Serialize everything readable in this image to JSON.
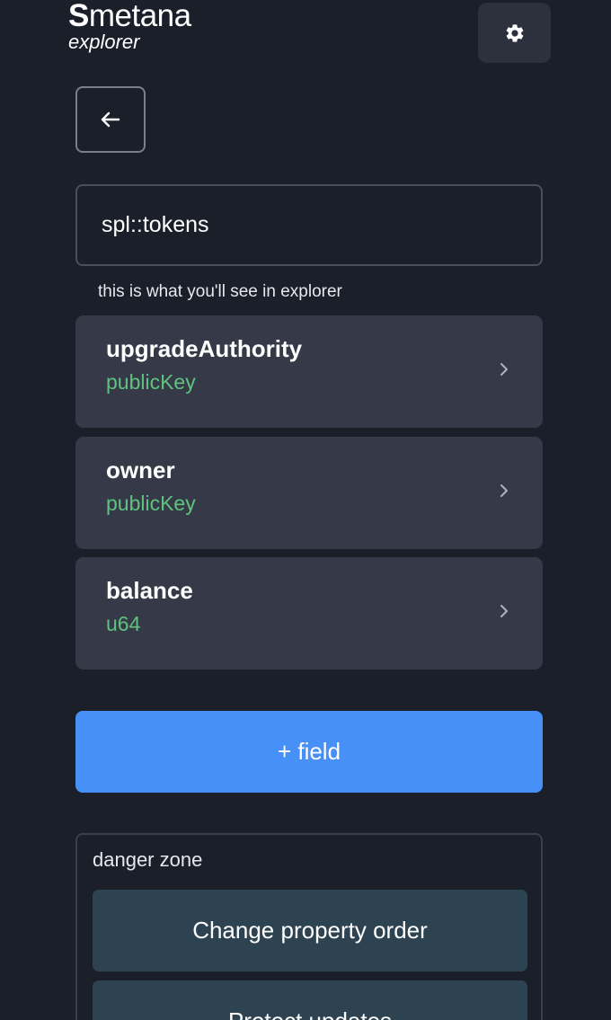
{
  "header": {
    "logo_first": "S",
    "logo_rest": "metana",
    "logo_subtitle": "explorer",
    "settings_icon": "gear-icon"
  },
  "nav": {
    "back_icon": "arrow-left-icon"
  },
  "program": {
    "name_value": "spl::tokens",
    "hint": "this is what you'll see in explorer"
  },
  "fields": [
    {
      "name": "upgradeAuthority",
      "type": "publicKey"
    },
    {
      "name": "owner",
      "type": "publicKey"
    },
    {
      "name": "balance",
      "type": "u64"
    }
  ],
  "actions": {
    "add_field_label": "+ field"
  },
  "danger_zone": {
    "title": "danger zone",
    "change_order_label": "Change property order",
    "protect_updates_label": "Protect updates"
  },
  "colors": {
    "background": "#1b1f2a",
    "accent": "#4790f7",
    "type_text": "#5fc27e",
    "row_bg": "#363a48",
    "danger_btn_bg": "#2e4351"
  }
}
